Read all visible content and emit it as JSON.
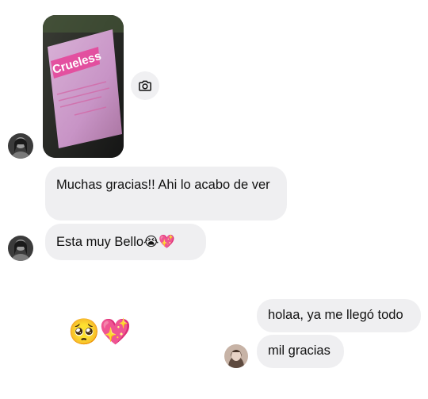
{
  "thread": {
    "photo": {
      "alt_icon": "package-photo",
      "brand": "Crueless"
    },
    "camera_icon": "camera-icon",
    "messages": [
      {
        "id": "m1",
        "text": "Muchas gracias!! Ahi lo acabo de ver"
      },
      {
        "id": "m2",
        "text": "Esta muy Bello",
        "emojis": "😭💖"
      }
    ],
    "reaction": {
      "face": "🥺",
      "heart": "💖"
    },
    "lower_messages": [
      {
        "id": "m3",
        "text": "holaa, ya me llegó todo"
      },
      {
        "id": "m4",
        "text": "mil gracias"
      }
    ]
  },
  "colors": {
    "bubble": "#efeff1",
    "background": "#ffffff"
  }
}
